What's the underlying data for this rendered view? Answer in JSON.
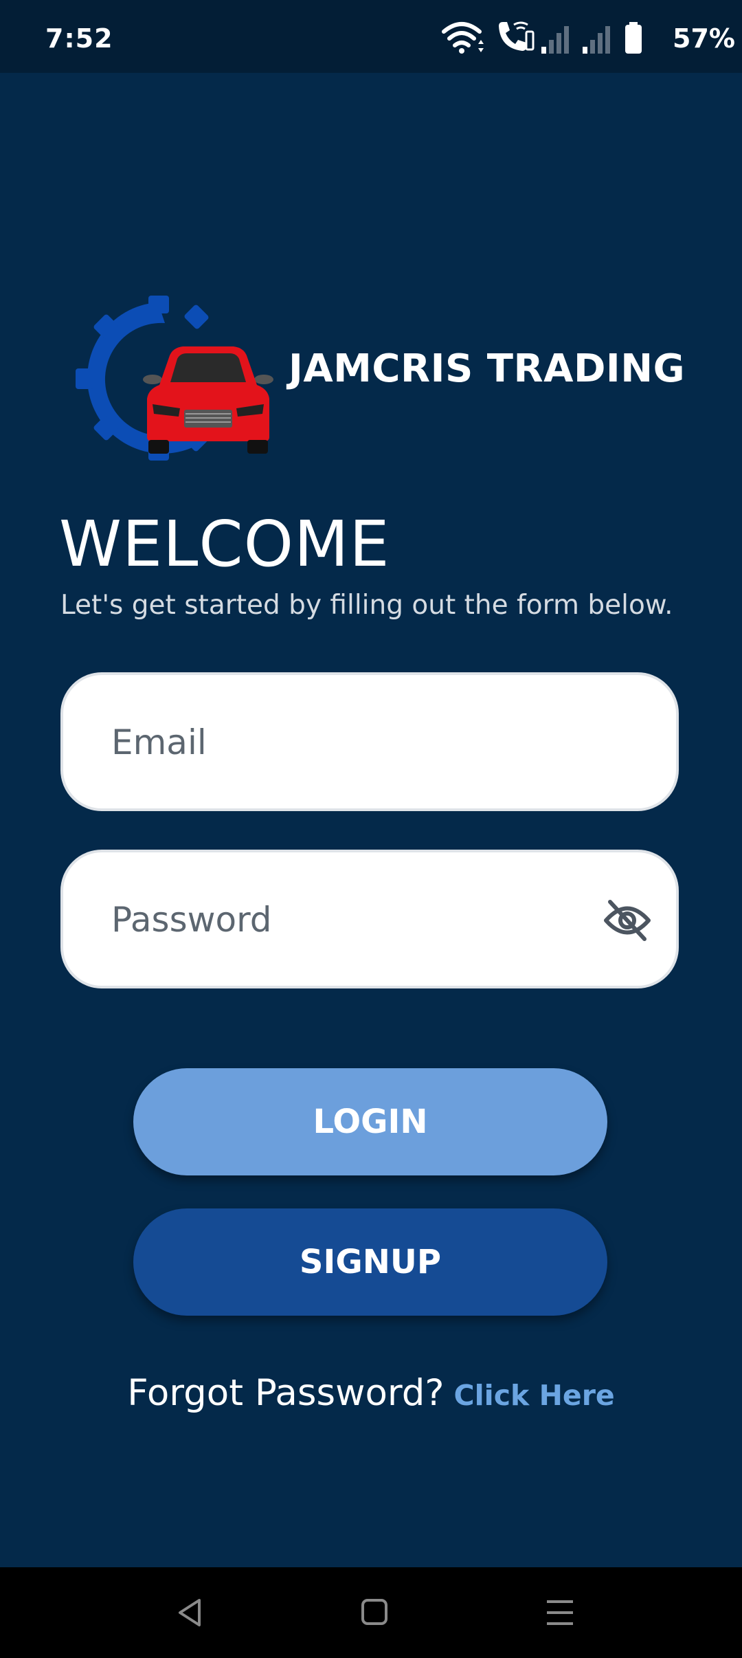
{
  "status_bar": {
    "time": "7:52",
    "battery_percent": "57%",
    "icons": [
      "wifi-icon",
      "wifi-calling-icon",
      "signal-icon",
      "signal-icon",
      "battery-icon"
    ]
  },
  "brand": {
    "name": "JAMCRIS TRADING",
    "logo_icon": "car-gear-logo",
    "colors": {
      "gear": "#0c4db5",
      "car": "#e3131b"
    }
  },
  "welcome": {
    "title": "WELCOME",
    "subtitle": "Let's get started by filling out the form below."
  },
  "form": {
    "email": {
      "placeholder": "Email",
      "value": ""
    },
    "password": {
      "placeholder": "Password",
      "value": "",
      "toggle_icon": "eye-off-icon"
    }
  },
  "buttons": {
    "login": "LOGIN",
    "signup": "SIGNUP"
  },
  "forgot": {
    "text": "Forgot Password?",
    "link": "Click Here"
  },
  "colors": {
    "background": "#04294a",
    "login_button": "#6c9fdc",
    "signup_button": "#154b94",
    "link": "#6ba5e2"
  },
  "nav_bar": {
    "icons": [
      "back-icon",
      "home-icon",
      "recents-icon"
    ]
  }
}
